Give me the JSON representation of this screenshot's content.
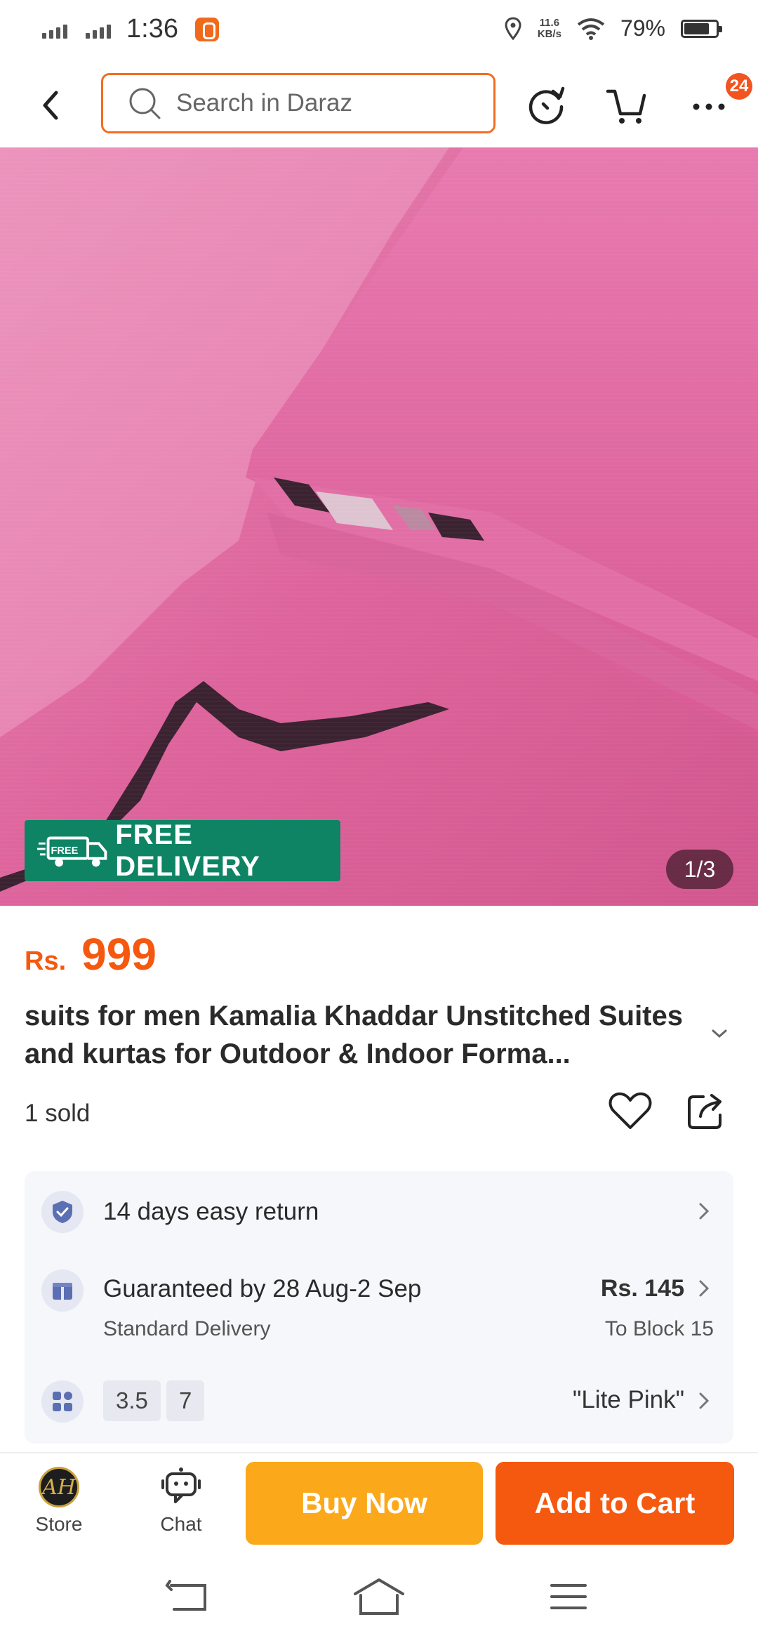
{
  "status_bar": {
    "time": "1:36",
    "net_speed_value": "11.6",
    "net_speed_unit": "KB/s",
    "battery_percent": "79%",
    "battery_level": 0.79
  },
  "header": {
    "search_placeholder": "Search in Daraz",
    "more_badge": "24"
  },
  "hero": {
    "free_delivery_label": "FREE DELIVERY",
    "free_icon_text": "FREE",
    "pager": "1/3",
    "fabric_color": "#e0669c"
  },
  "product": {
    "currency": "Rs.",
    "price": "999",
    "title": "suits for men Kamalia Khaddar Unstitched Suites and kurtas for Outdoor & Indoor Forma...",
    "sold": "1 sold"
  },
  "info_card": {
    "return_policy": "14 days easy return",
    "delivery_guarantee": "Guaranteed by 28 Aug-2 Sep",
    "delivery_type": "Standard Delivery",
    "shipping_fee": "Rs. 145",
    "shipping_destination": "To Block 15",
    "variant_chips": [
      "3.5",
      "7"
    ],
    "selected_color": "\"Lite Pink\""
  },
  "action_bar": {
    "store_label": "Store",
    "store_logo_text": "AH",
    "chat_label": "Chat",
    "buy_now_label": "Buy Now",
    "add_to_cart_label": "Add to Cart"
  },
  "colors": {
    "accent_orange": "#f5580f",
    "buy_now_yellow": "#fba81a",
    "free_delivery_green": "#0e8465"
  }
}
